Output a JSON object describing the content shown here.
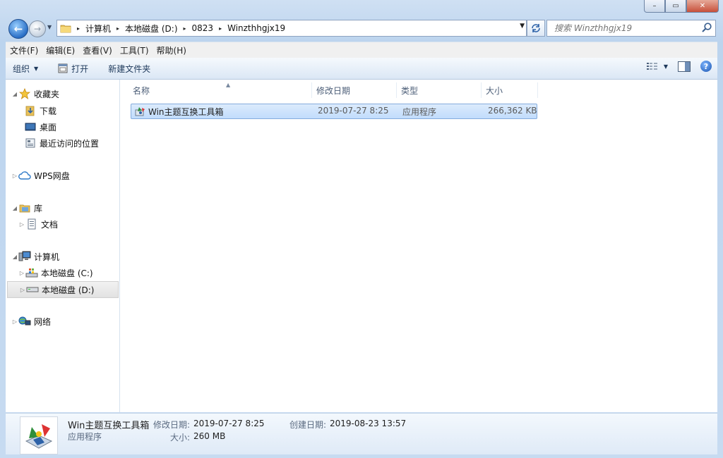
{
  "window": {
    "caption_minimize": "–",
    "caption_maximize": "▭",
    "caption_close": "✕"
  },
  "nav": {
    "back_glyph": "←",
    "forward_glyph": "→"
  },
  "address": {
    "crumbs": [
      "计算机",
      "本地磁盘 (D:)",
      "0823",
      "Winzthhgjx19"
    ],
    "separator": "▸"
  },
  "search": {
    "placeholder": "搜索 Winzthhgjx19"
  },
  "menu": [
    "文件(F)",
    "编辑(E)",
    "查看(V)",
    "工具(T)",
    "帮助(H)"
  ],
  "toolbar": {
    "organize": "组织",
    "open": "打开",
    "new_folder": "新建文件夹"
  },
  "sidebar": {
    "favorites": "收藏夹",
    "downloads": "下载",
    "desktop": "桌面",
    "recent": "最近访问的位置",
    "wps": "WPS网盘",
    "libraries": "库",
    "documents": "文档",
    "computer": "计算机",
    "drive_c": "本地磁盘 (C:)",
    "drive_d": "本地磁盘 (D:)",
    "network": "网络"
  },
  "columns": {
    "name": "名称",
    "modified": "修改日期",
    "type": "类型",
    "size": "大小"
  },
  "files": [
    {
      "name": "Win主题互换工具箱",
      "modified": "2019-07-27 8:25",
      "type": "应用程序",
      "size": "266,362 KB"
    }
  ],
  "details": {
    "name": "Win主题互换工具箱",
    "type": "应用程序",
    "modified_label": "修改日期:",
    "modified_value": "2019-07-27 8:25",
    "created_label": "创建日期:",
    "created_value": "2019-08-23 13:57",
    "size_label": "大小:",
    "size_value": "260 MB"
  },
  "colors": {
    "accent": "#2a6fc6",
    "selection": "#cce2fb",
    "selection_border": "#84acdd"
  },
  "icons": [
    "folder-icon",
    "star-icon",
    "download-folder-icon",
    "desktop-icon",
    "recent-icon",
    "cloud-icon",
    "library-icon",
    "document-icon",
    "computer-icon",
    "drive-icon",
    "network-icon",
    "app-icon",
    "search-icon",
    "refresh-icon",
    "help-icon",
    "view-icon",
    "preview-pane-icon"
  ]
}
